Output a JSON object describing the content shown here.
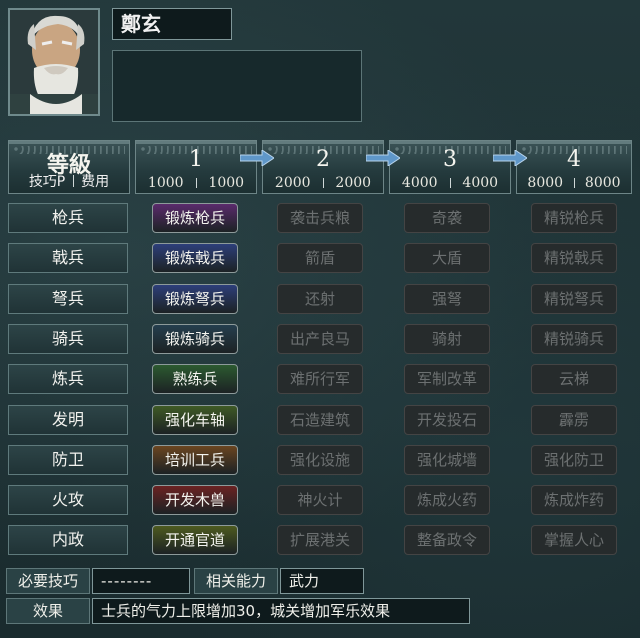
{
  "character": {
    "name": "鄭玄"
  },
  "header": {
    "title": "等級",
    "sub_left": "技巧P",
    "sub_right": "费用"
  },
  "levels": [
    {
      "num": "1",
      "cost_a": "1000",
      "cost_b": "1000"
    },
    {
      "num": "2",
      "cost_a": "2000",
      "cost_b": "2000"
    },
    {
      "num": "3",
      "cost_a": "4000",
      "cost_b": "4000"
    },
    {
      "num": "4",
      "cost_a": "8000",
      "cost_b": "8000"
    }
  ],
  "rows": [
    {
      "label": "枪兵",
      "color": "#5a2a6c",
      "skills": [
        "锻炼枪兵",
        "袭击兵粮",
        "奇袭",
        "精锐枪兵"
      ]
    },
    {
      "label": "戟兵",
      "color": "#2d3f7a",
      "skills": [
        "锻炼戟兵",
        "箭盾",
        "大盾",
        "精锐戟兵"
      ]
    },
    {
      "label": "弩兵",
      "color": "#2d3f7a",
      "skills": [
        "锻炼弩兵",
        "还射",
        "强弩",
        "精锐弩兵"
      ]
    },
    {
      "label": "骑兵",
      "color": "#253f4e",
      "skills": [
        "锻炼骑兵",
        "出产良马",
        "骑射",
        "精锐骑兵"
      ]
    },
    {
      "label": "炼兵",
      "color": "#2c5a30",
      "skills": [
        "熟练兵",
        "难所行军",
        "军制改革",
        "云梯"
      ]
    },
    {
      "label": "发明",
      "color": "#3f5a25",
      "skills": [
        "强化车轴",
        "石造建筑",
        "开发投石",
        "霹雳"
      ]
    },
    {
      "label": "防卫",
      "color": "#6a4520",
      "skills": [
        "培训工兵",
        "强化设施",
        "强化城墙",
        "强化防卫"
      ]
    },
    {
      "label": "火攻",
      "color": "#6a2222",
      "skills": [
        "开发木兽",
        "神火计",
        "炼成火药",
        "炼成炸药"
      ]
    },
    {
      "label": "内政",
      "color": "#4d5a1f",
      "skills": [
        "开通官道",
        "扩展港关",
        "整备政令",
        "掌握人心"
      ]
    }
  ],
  "footer": {
    "required_label": "必要技巧",
    "required_value": "--------",
    "related_label": "相关能力",
    "related_value": "武力",
    "effect_label": "效果",
    "effect_value": "士兵的气力上限增加30，城关增加军乐效果"
  }
}
